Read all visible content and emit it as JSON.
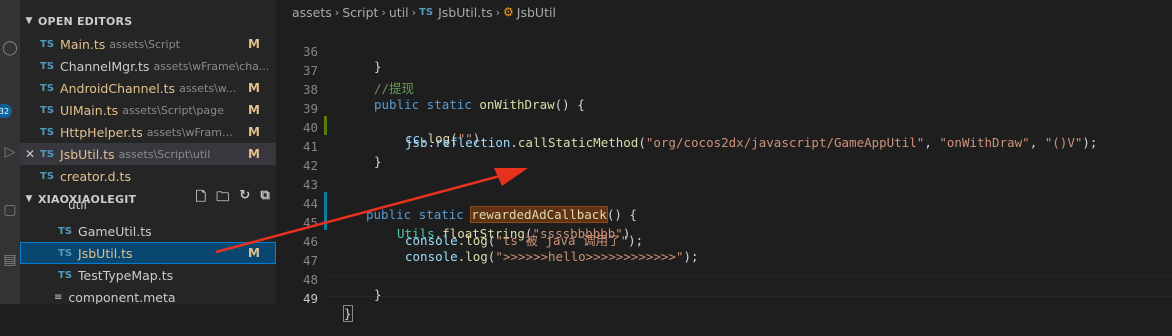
{
  "sidebar": {
    "open_editors_title": "OPEN EDITORS",
    "open_editors": [
      {
        "type": "TS",
        "name": "Main.ts",
        "path": "assets\\Script",
        "status": "M"
      },
      {
        "type": "TS",
        "name": "ChannelMgr.ts",
        "path": "assets\\wFrame\\cha...",
        "status": ""
      },
      {
        "type": "TS",
        "name": "AndroidChannel.ts",
        "path": "assets\\w...",
        "status": "M"
      },
      {
        "type": "TS",
        "name": "UIMain.ts",
        "path": "assets\\Script\\page",
        "status": "M"
      },
      {
        "type": "TS",
        "name": "HttpHelper.ts",
        "path": "assets\\wFrame...",
        "status": "M"
      },
      {
        "type": "TS",
        "name": "JsbUtil.ts",
        "path": "assets\\Script\\util",
        "status": "M",
        "close": "✕"
      },
      {
        "type": "TS",
        "name": "creator.d.ts",
        "path": "",
        "status": ""
      }
    ],
    "project_title": "XIAOXIAOLEGIT",
    "folder_util": "util",
    "tree": [
      {
        "type": "TS",
        "name": "GameUtil.ts",
        "status": ""
      },
      {
        "type": "TS",
        "name": "JsbUtil.ts",
        "status": "M"
      },
      {
        "type": "TS",
        "name": "TestTypeMap.ts",
        "status": ""
      }
    ],
    "component_meta": "component.meta",
    "badge": "32"
  },
  "breadcrumb": {
    "items": [
      "assets",
      "Script",
      "util"
    ],
    "file_type": "TS",
    "file": "JsbUtil.ts",
    "symbol": "JsbUtil"
  },
  "code": {
    "line_numbers": [
      "36",
      "37",
      "38",
      "39",
      "40",
      "41",
      "42",
      "43",
      "44",
      "45",
      "46",
      "47",
      "48",
      "49"
    ],
    "l36": "}",
    "l37": "//提现",
    "l38_kw": "public static ",
    "l38_fn": "onWithDraw",
    "l38_rest": "() {",
    "l39_var": "cc",
    "l39_fn": "log",
    "l39_str": "\"\"",
    "l40_var": "jsb",
    "l40_var2": "reflection",
    "l40_fn": "callStaticMethod",
    "l40_s1": "\"org/cocos2dx/javascript/GameAppUtil\"",
    "l40_s2": "\"onWithDraw\"",
    "l40_s3": "\"()V\"",
    "l41": "}",
    "l43_kw": "public static ",
    "l43_fn": "rewardedAdCallback",
    "l43_rest": "() {",
    "l44_cls": "Utils",
    "l44_fn": "floatString",
    "l44_str": "\"ssssbbbbbb\"",
    "l45_var": "console",
    "l45_fn": "log",
    "l45_str": "\"ts 被 java 调用了\"",
    "l46_var": "console",
    "l46_fn": "log",
    "l46_str": "\">>>>>>hello>>>>>>>>>>>>\"",
    "l48": "}",
    "l49": "}"
  },
  "colors": {
    "added": "#587c0c",
    "modified": "#0c7d9d",
    "arrow": "#e8301f"
  }
}
